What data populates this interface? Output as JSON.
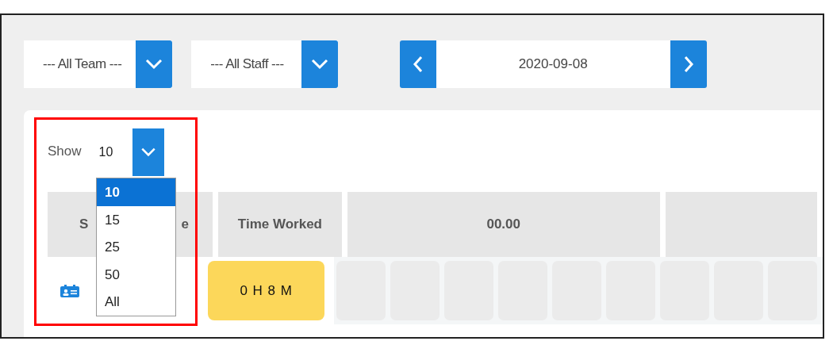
{
  "filters": {
    "team": {
      "value": "--- All Team ---"
    },
    "staff": {
      "value": "--- All Staff ---"
    }
  },
  "date_nav": {
    "value": "2020-09-08"
  },
  "show": {
    "label": "Show",
    "value": "10",
    "options": [
      {
        "label": "10",
        "selected": true
      },
      {
        "label": "15",
        "selected": false
      },
      {
        "label": "25",
        "selected": false
      },
      {
        "label": "50",
        "selected": false
      },
      {
        "label": "All",
        "selected": false
      }
    ]
  },
  "table": {
    "columns": [
      {
        "parts": [
          "S",
          "e"
        ]
      },
      {
        "label": "Time Worked"
      },
      {
        "label": "00.00"
      }
    ],
    "rows": [
      {
        "time_worked": "0 H 8 M"
      }
    ]
  }
}
